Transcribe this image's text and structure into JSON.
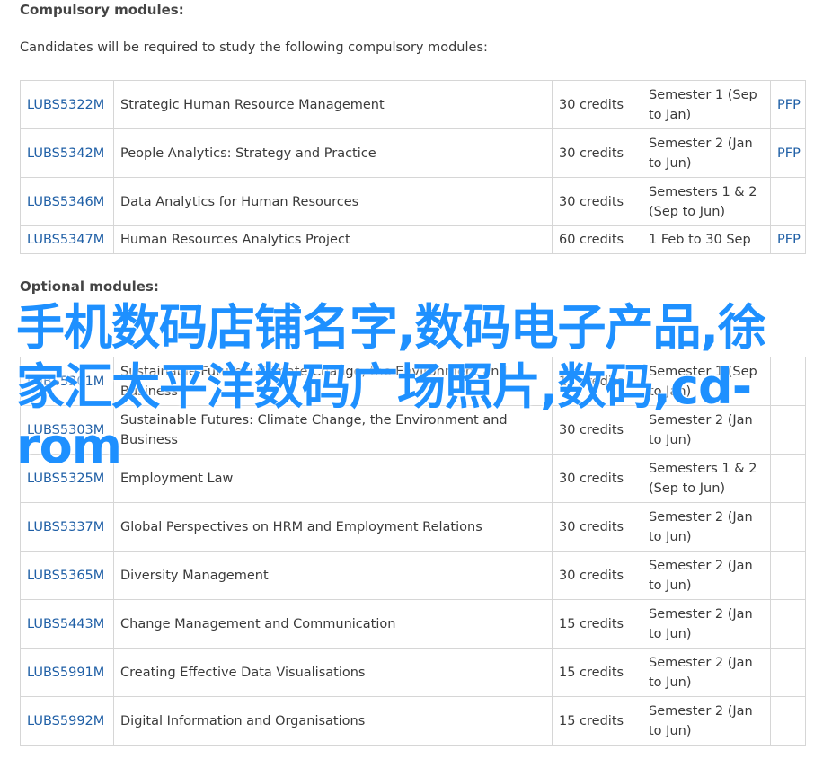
{
  "compulsory": {
    "heading": "Compulsory modules:",
    "intro": "Candidates will be required to study the following compulsory modules:",
    "rows": [
      {
        "code": "LUBS5322M",
        "title": "Strategic Human Resource Management",
        "credits": "30 credits",
        "semester": "Semester 1 (Sep to Jan)",
        "pfp": "PFP"
      },
      {
        "code": "LUBS5342M",
        "title": "People Analytics: Strategy and Practice",
        "credits": "30 credits",
        "semester": "Semester 2 (Jan to Jun)",
        "pfp": "PFP"
      },
      {
        "code": "LUBS5346M",
        "title": "Data Analytics for Human Resources",
        "credits": "30 credits",
        "semester": "Semesters 1 & 2 (Sep to Jun)",
        "pfp": ""
      },
      {
        "code": "LUBS5347M",
        "title": "Human Resources Analytics Project",
        "credits": "60 credits",
        "semester": "1 Feb to 30 Sep",
        "pfp": "PFP"
      }
    ]
  },
  "optional": {
    "heading": "Optional modules:",
    "rows": [
      {
        "code": "LUBS5301M",
        "title": "Sustainable Futures: Climate Change, the Environment and Business",
        "credits": "15 credits",
        "semester": "Semester 1 (Sep to Jan)"
      },
      {
        "code": "LUBS5303M",
        "title": "Sustainable Futures: Climate Change, the Environment and Business",
        "credits": "30 credits",
        "semester": "Semester 2 (Jan to Jun)"
      },
      {
        "code": "LUBS5325M",
        "title": "Employment Law",
        "credits": "30 credits",
        "semester": "Semesters 1 & 2 (Sep to Jun)"
      },
      {
        "code": "LUBS5337M",
        "title": "Global Perspectives on HRM and Employment Relations",
        "credits": "30 credits",
        "semester": "Semester 2 (Jan to Jun)"
      },
      {
        "code": "LUBS5365M",
        "title": "Diversity Management",
        "credits": "30 credits",
        "semester": "Semester 2 (Jan to Jun)"
      },
      {
        "code": "LUBS5443M",
        "title": "Change Management and Communication",
        "credits": "15 credits",
        "semester": "Semester 2 (Jan to Jun)"
      },
      {
        "code": "LUBS5991M",
        "title": "Creating Effective Data Visualisations",
        "credits": "15 credits",
        "semester": "Semester 2 (Jan to Jun)"
      },
      {
        "code": "LUBS5992M",
        "title": "Digital Information and Organisations",
        "credits": "15 credits",
        "semester": "Semester 2 (Jan to Jun)"
      }
    ]
  },
  "overlay": {
    "text": "手机数码店铺名字,数码电子产品,徐家汇太平洋数码广场照片,数码,cd-rom"
  },
  "colors": {
    "link": "#1f5fa6",
    "overlay": "#1e90ff",
    "border": "#d6d6d6"
  }
}
